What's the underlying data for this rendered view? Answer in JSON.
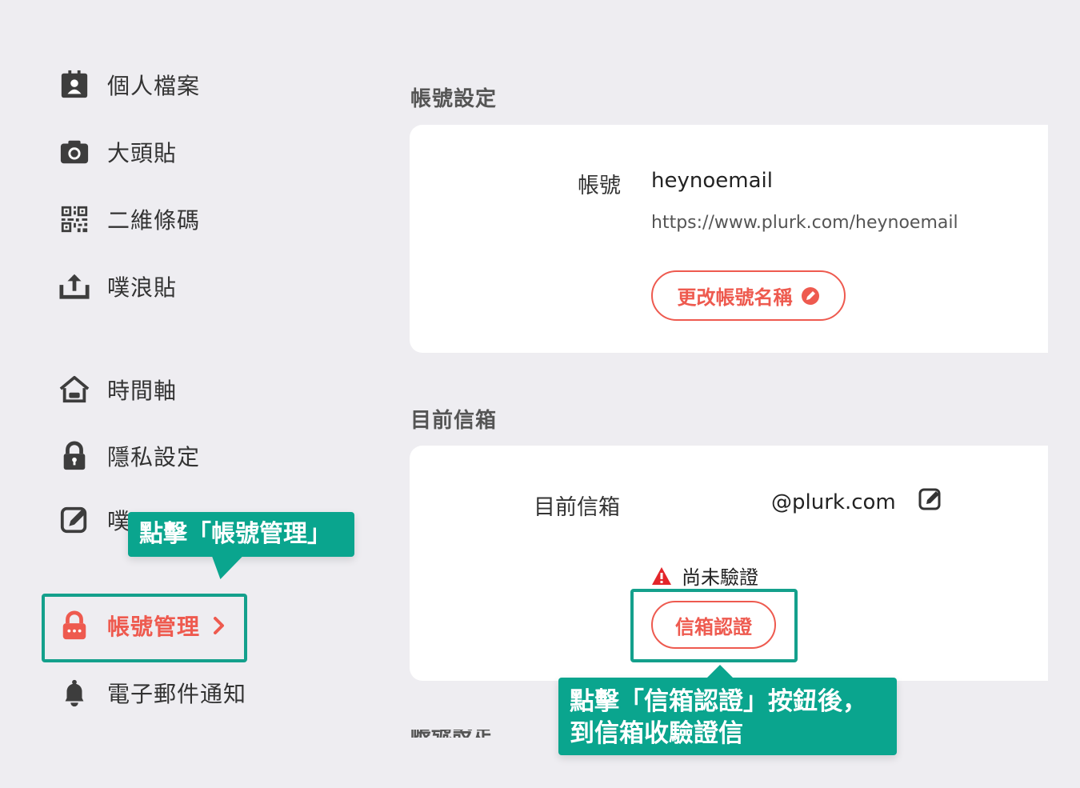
{
  "sidebar": {
    "items": [
      {
        "label": "個人檔案",
        "icon": "profile-card-icon"
      },
      {
        "label": "大頭貼",
        "icon": "camera-icon"
      },
      {
        "label": "二維條碼",
        "icon": "qr-code-icon"
      },
      {
        "label": "噗浪貼",
        "icon": "upload-icon"
      },
      {
        "label": "時間軸",
        "icon": "home-icon"
      },
      {
        "label": "隱私設定",
        "icon": "lock-icon"
      },
      {
        "label": "噗",
        "icon": "edit-icon"
      },
      {
        "label": "帳號管理",
        "icon": "account-lock-icon",
        "active": true
      },
      {
        "label": "電子郵件通知",
        "icon": "bell-icon"
      }
    ]
  },
  "callouts": {
    "account_manage": "點擊「帳號管理」",
    "verify_line1": "點擊「信箱認證」按鈕後，",
    "verify_line2": "到信箱收驗證信"
  },
  "account_section": {
    "title": "帳號設定",
    "label": "帳號",
    "username": "heynoemail",
    "url": "https://www.plurk.com/heynoemail",
    "rename_button": "更改帳號名稱"
  },
  "email_section": {
    "title": "目前信箱",
    "label": "目前信箱",
    "email": "@plurk.com",
    "status": "尚未驗證",
    "verify_button": "信箱認證"
  },
  "next_section": {
    "title": "帳號設定"
  },
  "colors": {
    "accent": "#ee5a4f",
    "callout": "#0aa58e",
    "background": "#eeedf1"
  }
}
